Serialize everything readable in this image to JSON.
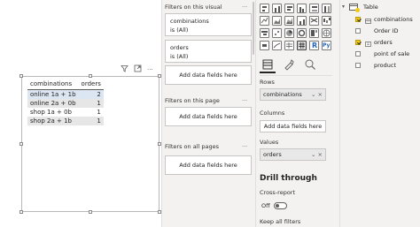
{
  "visual": {
    "header_icons": [
      "filter-icon",
      "focus-mode-icon",
      "more-options-icon"
    ],
    "more_glyph": "···",
    "columns": [
      "combinations",
      "orders"
    ],
    "rows": [
      {
        "combination": "online 1a + 1b",
        "orders": "2"
      },
      {
        "combination": "online 2a + 0b",
        "orders": "1"
      },
      {
        "combination": "shop 1a + 0b",
        "orders": "1"
      },
      {
        "combination": "shop 2a + 1b",
        "orders": "1"
      }
    ]
  },
  "filters": {
    "visual_title": "Filters on this visual",
    "cards": [
      {
        "name": "combinations",
        "value": "is (All)"
      },
      {
        "name": "orders",
        "value": "is (All)"
      }
    ],
    "add_label": "Add data fields here",
    "page_title": "Filters on this page",
    "all_pages_title": "Filters on all pages",
    "dots": "···"
  },
  "visualizations": {
    "rows_label": "Rows",
    "rows_value": "combinations",
    "columns_label": "Columns",
    "columns_add": "Add data fields here",
    "values_label": "Values",
    "values_value": "orders",
    "drill_title": "Drill through",
    "cross_report_label": "Cross-report",
    "toggle_label": "Off",
    "keep_filters_label": "Keep all filters",
    "well_controls": "⌄ ×",
    "icon_r": "R",
    "icon_py": "Py"
  },
  "fields": {
    "table_name": "Table",
    "items": [
      {
        "name": "combinations",
        "checked": true
      },
      {
        "name": "Order ID",
        "checked": false
      },
      {
        "name": "orders",
        "checked": true
      },
      {
        "name": "point of sale",
        "checked": false
      },
      {
        "name": "product",
        "checked": false
      }
    ]
  },
  "colors": {
    "accent_yellow": "#f2c811",
    "pane_bg": "#f3f2f1",
    "selected_row": "#dce6f2"
  }
}
